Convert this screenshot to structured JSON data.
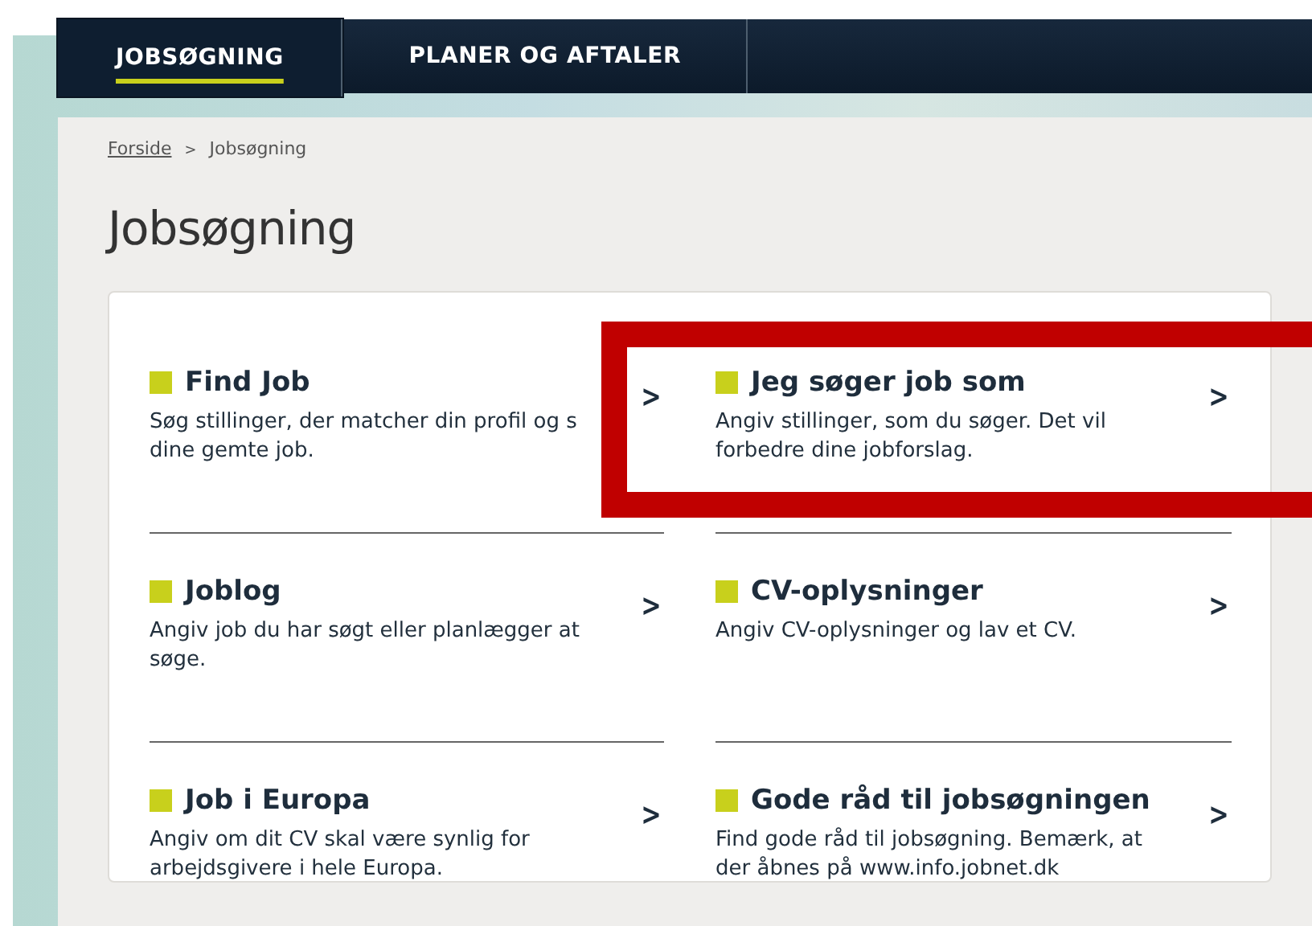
{
  "nav_tabs": [
    {
      "label": "JOBSØGNING",
      "selected": true
    },
    {
      "label": "PLANER OG AFTALER",
      "selected": false
    }
  ],
  "breadcrumb": [
    {
      "label": "Forside",
      "kind": "link"
    },
    {
      "label": ">",
      "kind": "separator"
    },
    {
      "label": "Jobsøgning",
      "kind": "current"
    }
  ],
  "page_title": "Jobsøgning",
  "items": [
    {
      "title": "Find Job",
      "description": "Søg stillinger, der matcher din profil og s dine gemte job.",
      "chevron": ">"
    },
    {
      "title": "Jeg søger job som",
      "description": "Angiv stillinger, som du søger. Det vil forbedre dine jobforslag.",
      "chevron": ">"
    },
    {
      "title": "Joblog",
      "description": "Angiv job du har søgt eller planlægger at søge.",
      "chevron": ">"
    },
    {
      "title": "CV-oplysninger",
      "description": "Angiv CV-oplysninger og lav et CV.",
      "chevron": ">"
    },
    {
      "title": "Job i Europa",
      "description": "Angiv om dit CV skal være synlig for arbejdsgivere i hele Europa.",
      "chevron": ">"
    },
    {
      "title": "Gode råd til jobsøgningen",
      "description": "Find gode råd til jobsøgning. Bemærk, at der åbnes på www.info.jobnet.dk",
      "chevron": ">"
    }
  ]
}
